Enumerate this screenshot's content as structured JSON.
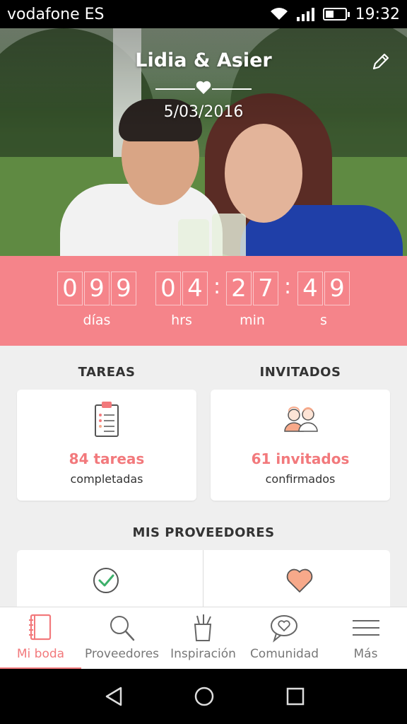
{
  "status_bar": {
    "carrier": "vodafone ES",
    "time": "19:32",
    "icons": [
      "wifi-icon",
      "signal-icon",
      "battery-icon"
    ]
  },
  "hero": {
    "couple_names": "Lidia & Asier",
    "date": "5/03/2016",
    "icons": [
      "heart-icon",
      "edit-pencil-icon"
    ]
  },
  "countdown": {
    "days": [
      "0",
      "9",
      "9"
    ],
    "hours": [
      "0",
      "4"
    ],
    "minutes": [
      "2",
      "7"
    ],
    "seconds": [
      "4",
      "9"
    ],
    "labels": {
      "days": "días",
      "hours": "hrs",
      "minutes": "min",
      "seconds": "s"
    },
    "colors": {
      "background": "#f5848a"
    }
  },
  "tareas": {
    "title": "TAREAS",
    "count_text": "84 tareas",
    "subtitle": "completadas",
    "icon": "clipboard-icon"
  },
  "invitados": {
    "title": "INVITADOS",
    "count_text": "61 invitados",
    "subtitle": "confirmados",
    "icon": "guests-icon"
  },
  "proveedores": {
    "title": "MIS PROVEEDORES",
    "icons": [
      "check-circle-icon",
      "heart-icon"
    ]
  },
  "bottom_nav": {
    "items": [
      {
        "label": "Mi boda",
        "icon": "notebook-icon",
        "active": true
      },
      {
        "label": "Proveedores",
        "icon": "search-icon",
        "active": false
      },
      {
        "label": "Inspiración",
        "icon": "inspiration-cup-icon",
        "active": false
      },
      {
        "label": "Comunidad",
        "icon": "chat-heart-icon",
        "active": false
      },
      {
        "label": "Más",
        "icon": "menu-icon",
        "active": false
      }
    ]
  },
  "colors": {
    "accent": "#f2797c",
    "icon_peach": "#f7a98a"
  }
}
